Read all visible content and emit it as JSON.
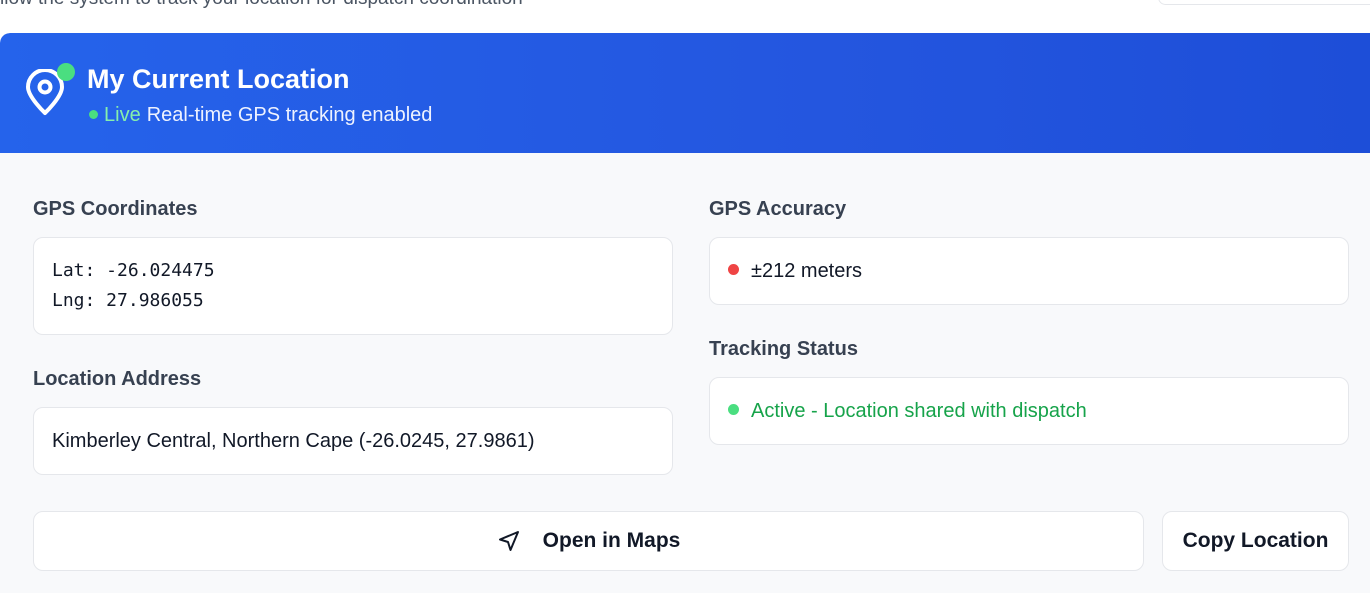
{
  "topbar": {
    "partial_text": "llow the system to track your location for dispatch coordination"
  },
  "header": {
    "title": "My Current Location",
    "live_label": "Live",
    "subtitle": "Real-time GPS tracking enabled",
    "icon": "map-pin-icon",
    "live_color": "#4ade80"
  },
  "coordinates": {
    "label": "GPS Coordinates",
    "lat": "Lat: -26.024475",
    "lng": "Lng: 27.986055"
  },
  "address": {
    "label": "Location Address",
    "value": "Kimberley Central, Northern Cape (-26.0245, 27.9861)"
  },
  "accuracy": {
    "label": "GPS Accuracy",
    "value": "±212 meters",
    "status_color": "#ef4444"
  },
  "tracking": {
    "label": "Tracking Status",
    "value": "Active - Location shared with dispatch",
    "status_color": "#4ade80",
    "text_color": "#16a34a"
  },
  "actions": {
    "open_maps_label": "Open in Maps",
    "open_maps_icon": "navigation-arrow-icon",
    "copy_label": "Copy Location"
  }
}
